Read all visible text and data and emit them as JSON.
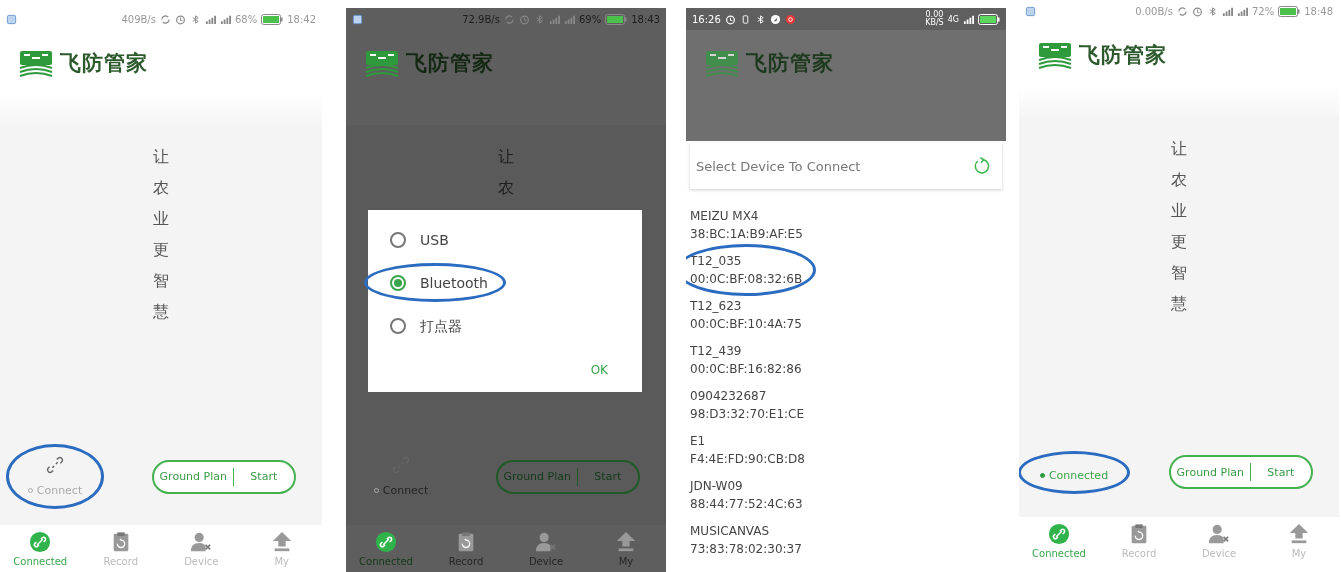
{
  "panels": [
    {
      "kind": "home",
      "status_bar": {
        "speed": "409B/s",
        "battery": "68%",
        "time": "18:42"
      },
      "app_title": "飞防管家",
      "slogan": "让农业更智慧",
      "connection": {
        "label": "Connect",
        "connected": false,
        "circled": true
      },
      "buttons": [
        "Ground Plan",
        "Start"
      ],
      "nav": [
        {
          "label": "Connected",
          "selected": true
        },
        {
          "label": "Record",
          "selected": false
        },
        {
          "label": "Device",
          "selected": false
        },
        {
          "label": "My",
          "selected": false
        }
      ]
    },
    {
      "kind": "dialog",
      "status_bar": {
        "speed": "72.9B/s",
        "battery": "69%",
        "time": "18:43"
      },
      "app_title": "飞防管家",
      "slogan": "让农",
      "connection": {
        "label": "Connect",
        "connected": false,
        "circled": false
      },
      "buttons": [
        "Ground Plan",
        "Start"
      ],
      "nav": [
        {
          "label": "Connected",
          "selected": true
        },
        {
          "label": "Record",
          "selected": false
        },
        {
          "label": "Device",
          "selected": false
        },
        {
          "label": "My",
          "selected": false
        }
      ],
      "dialog": {
        "options": [
          {
            "label": "USB",
            "selected": false,
            "circled": false
          },
          {
            "label": "Bluetooth",
            "selected": true,
            "circled": true
          },
          {
            "label": "打点器",
            "selected": false,
            "circled": false
          }
        ],
        "ok": "OK"
      }
    },
    {
      "kind": "device-list",
      "status_bar": {
        "time": "16:26",
        "speed": "0.00",
        "speed_unit": "KB/S",
        "network": "4G"
      },
      "app_title": "飞防管家",
      "picker": {
        "title": "Select Device To Connect",
        "devices": [
          {
            "name": "MEIZU MX4",
            "address": "38:BC:1A:B9:AF:E5",
            "circled": false
          },
          {
            "name": "T12_035",
            "address": "00:0C:BF:08:32:6B",
            "circled": true
          },
          {
            "name": "T12_623",
            "address": "00:0C:BF:10:4A:75",
            "circled": false
          },
          {
            "name": "T12_439",
            "address": "00:0C:BF:16:82:86",
            "circled": false
          },
          {
            "name": "0904232687",
            "address": "98:D3:32:70:E1:CE",
            "circled": false
          },
          {
            "name": "E1",
            "address": "F4:4E:FD:90:CB:D8",
            "circled": false
          },
          {
            "name": "JDN-W09",
            "address": "88:44:77:52:4C:63",
            "circled": false
          },
          {
            "name": "MUSICANVAS",
            "address": "73:83:78:02:30:37",
            "circled": false
          }
        ]
      }
    },
    {
      "kind": "home",
      "status_bar": {
        "speed": "0.00B/s",
        "battery": "72%",
        "time": "18:48"
      },
      "app_title": "飞防管家",
      "slogan": "让农业更智慧",
      "connection": {
        "label": "Connected",
        "connected": true,
        "circled": true
      },
      "buttons": [
        "Ground Plan",
        "Start"
      ],
      "nav": [
        {
          "label": "Connected",
          "selected": true
        },
        {
          "label": "Record",
          "selected": false
        },
        {
          "label": "Device",
          "selected": false
        },
        {
          "label": "My",
          "selected": false
        }
      ]
    }
  ]
}
